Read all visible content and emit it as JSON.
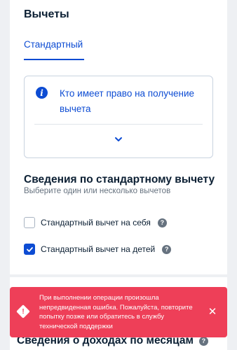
{
  "deductions": {
    "title": "Вычеты",
    "tab_label": "Стандартный",
    "info_link": "Кто имеет право на получение вычета"
  },
  "standard": {
    "title": "Сведения по стандартному вычету",
    "subtitle": "Выберите один или несколько вычетов",
    "options": [
      {
        "label": "Стандартный вычет на себя",
        "checked": false
      },
      {
        "label": "Стандартный вычет на детей",
        "checked": true
      }
    ]
  },
  "income": {
    "title": "Сведения о доходах по месяцам"
  },
  "toast": {
    "message": "При выполнении операции произошла непредвиденная ошибка. Пожалуйста, повторите попытку позже или обратитесь в службу технической поддержки",
    "icon": "warning-icon",
    "close_symbol": "✕"
  },
  "colors": {
    "accent": "#0d4cd3",
    "error": "#ee3f58",
    "text": "#0b1f33"
  }
}
